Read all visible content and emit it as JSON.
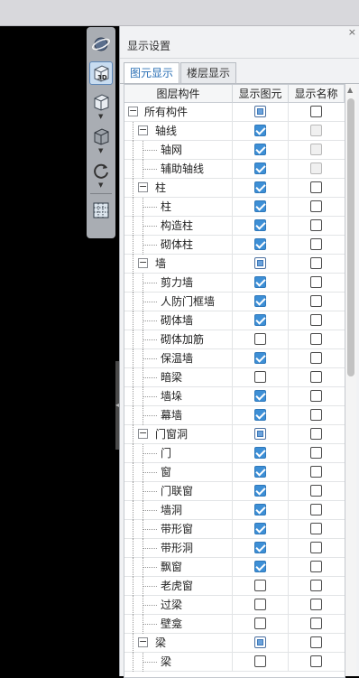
{
  "panel": {
    "title": "显示设置",
    "close_glyph": "×",
    "tabs": [
      "图元显示",
      "楼层显示"
    ],
    "active_tab": 0
  },
  "columns": [
    "图层构件",
    "显示图元",
    "显示名称"
  ],
  "toolbar": {
    "buttons": [
      "orbit-icon",
      "view-3d-icon",
      "view-iso-icon",
      "view-solid-icon",
      "rotate-icon",
      "grid-view-icon"
    ],
    "badge_3d": "3D"
  },
  "rows": [
    {
      "label": "所有构件",
      "level": 0,
      "expander": "−",
      "show": "partial",
      "name": "unchecked"
    },
    {
      "label": "轴线",
      "level": 1,
      "expander": "−",
      "show": "checked",
      "name": "disabled"
    },
    {
      "label": "轴网",
      "level": 2,
      "show": "checked",
      "name": "disabled"
    },
    {
      "label": "辅助轴线",
      "level": 2,
      "show": "checked",
      "name": "disabled"
    },
    {
      "label": "柱",
      "level": 1,
      "expander": "−",
      "show": "checked",
      "name": "unchecked"
    },
    {
      "label": "柱",
      "level": 2,
      "show": "checked",
      "name": "unchecked"
    },
    {
      "label": "构造柱",
      "level": 2,
      "show": "checked",
      "name": "unchecked"
    },
    {
      "label": "砌体柱",
      "level": 2,
      "show": "checked",
      "name": "unchecked"
    },
    {
      "label": "墙",
      "level": 1,
      "expander": "−",
      "show": "partial",
      "name": "unchecked"
    },
    {
      "label": "剪力墙",
      "level": 2,
      "show": "checked",
      "name": "unchecked"
    },
    {
      "label": "人防门框墙",
      "level": 2,
      "show": "checked",
      "name": "unchecked"
    },
    {
      "label": "砌体墙",
      "level": 2,
      "show": "checked",
      "name": "unchecked"
    },
    {
      "label": "砌体加筋",
      "level": 2,
      "show": "unchecked",
      "name": "unchecked"
    },
    {
      "label": "保温墙",
      "level": 2,
      "show": "checked",
      "name": "unchecked"
    },
    {
      "label": "暗梁",
      "level": 2,
      "show": "unchecked",
      "name": "unchecked"
    },
    {
      "label": "墙垛",
      "level": 2,
      "show": "checked",
      "name": "unchecked"
    },
    {
      "label": "幕墙",
      "level": 2,
      "show": "checked",
      "name": "unchecked"
    },
    {
      "label": "门窗洞",
      "level": 1,
      "expander": "−",
      "show": "partial",
      "name": "unchecked"
    },
    {
      "label": "门",
      "level": 2,
      "show": "checked",
      "name": "unchecked"
    },
    {
      "label": "窗",
      "level": 2,
      "show": "checked",
      "name": "unchecked"
    },
    {
      "label": "门联窗",
      "level": 2,
      "show": "checked",
      "name": "unchecked"
    },
    {
      "label": "墙洞",
      "level": 2,
      "show": "checked",
      "name": "unchecked"
    },
    {
      "label": "带形窗",
      "level": 2,
      "show": "checked",
      "name": "unchecked"
    },
    {
      "label": "带形洞",
      "level": 2,
      "show": "checked",
      "name": "unchecked"
    },
    {
      "label": "飘窗",
      "level": 2,
      "show": "checked",
      "name": "unchecked"
    },
    {
      "label": "老虎窗",
      "level": 2,
      "show": "unchecked",
      "name": "unchecked"
    },
    {
      "label": "过梁",
      "level": 2,
      "show": "unchecked",
      "name": "unchecked"
    },
    {
      "label": "壁龛",
      "level": 2,
      "show": "unchecked",
      "name": "unchecked"
    },
    {
      "label": "梁",
      "level": 1,
      "expander": "−",
      "show": "partial",
      "name": "unchecked"
    },
    {
      "label": "梁",
      "level": 2,
      "show": "unchecked",
      "name": "unchecked"
    }
  ],
  "colors": {
    "accent": "#3d8fd6",
    "active_tab_text": "#2a6fb5"
  }
}
